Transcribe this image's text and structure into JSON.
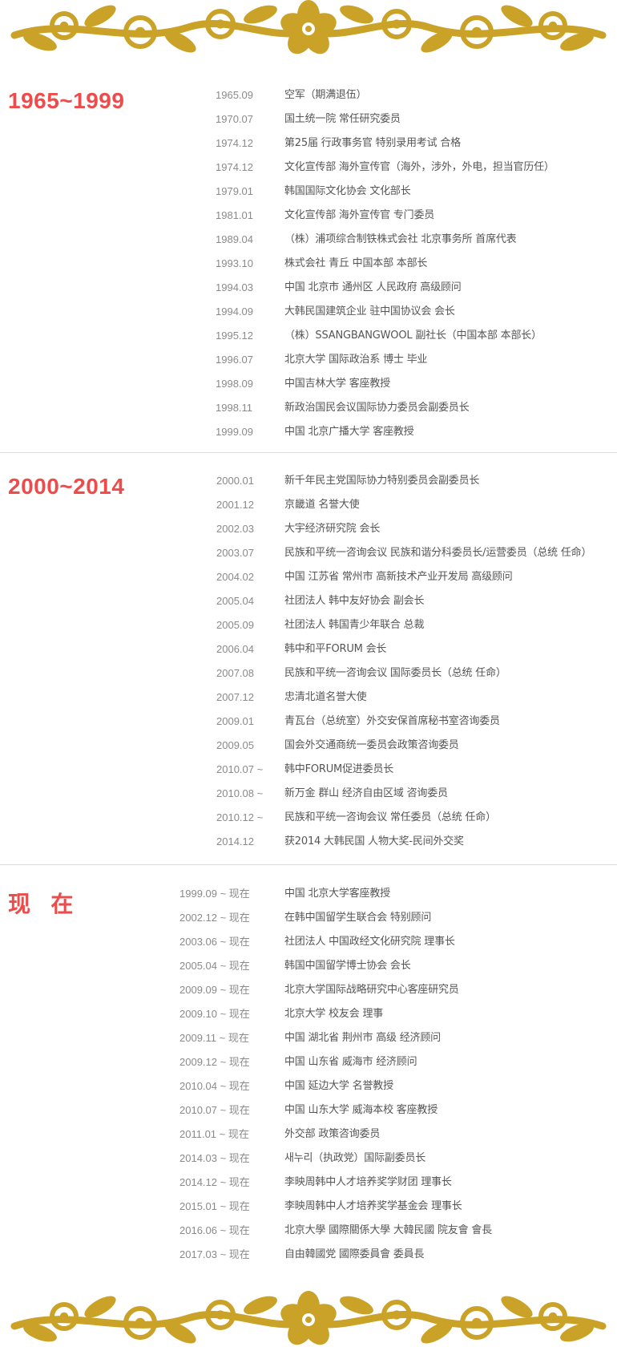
{
  "ornament": {
    "color": "#c9a227",
    "icon": "floral-ornament"
  },
  "sections": [
    {
      "title": "1965~1999",
      "entries": [
        {
          "date": "1965.09",
          "desc": "空军（期满退伍）"
        },
        {
          "date": "1970.07",
          "desc": "国土统一院 常任研究委员"
        },
        {
          "date": "1974.12",
          "desc": "第25届 行政事务官 特别录用考试 合格"
        },
        {
          "date": "1974.12",
          "desc": "文化宣传部 海外宣传官（海外，涉外，外电，担当官历任）"
        },
        {
          "date": "1979.01",
          "desc": "韩国国际文化协会 文化部长"
        },
        {
          "date": "1981.01",
          "desc": "文化宣传部 海外宣传官 专门委员"
        },
        {
          "date": "1989.04",
          "desc": "（株）浦项综合制铁株式会社 北京事务所 首席代表"
        },
        {
          "date": "1993.10",
          "desc": "株式会社 青丘 中国本部  本部长"
        },
        {
          "date": "1994.03",
          "desc": "中国 北京市 通州区 人民政府 高级顾问"
        },
        {
          "date": "1994.09",
          "desc": "大韩民国建筑企业 驻中国协议会 会长"
        },
        {
          "date": "1995.12",
          "desc": "（株）SSANGBANGWOOL 副社长（中国本部 本部长）"
        },
        {
          "date": "1996.07",
          "desc": "北京大学 国际政治系 博士 毕业"
        },
        {
          "date": "1998.09",
          "desc": "中国吉林大学 客座教授"
        },
        {
          "date": "1998.11",
          "desc": "新政治国民会议国际协力委员会副委员长"
        },
        {
          "date": "1999.09",
          "desc": "中国 北京广播大学 客座教授"
        }
      ]
    },
    {
      "title": "2000~2014",
      "entries": [
        {
          "date": "2000.01",
          "desc": "新千年民主党国际协力特别委员会副委员长"
        },
        {
          "date": "2001.12",
          "desc": "京畿道 名誉大使"
        },
        {
          "date": "2002.03",
          "desc": "大宇经济研究院 会长"
        },
        {
          "date": "2003.07",
          "desc": "民族和平统一咨询会议 民族和谐分科委员长/运营委员（总统 任命）"
        },
        {
          "date": "2004.02",
          "desc": "中国 江苏省 常州市 高新技术产业开发局 高级顾问"
        },
        {
          "date": "2005.04",
          "desc": "社团法人 韩中友好协会 副会长"
        },
        {
          "date": "2005.09",
          "desc": "社团法人 韩国青少年联合 总裁"
        },
        {
          "date": "2006.04",
          "desc": "韩中和平FORUM 会长"
        },
        {
          "date": "2007.08",
          "desc": "民族和平统一咨询会议 国际委员长（总统 任命）"
        },
        {
          "date": "2007.12",
          "desc": "忠清北道名誉大使"
        },
        {
          "date": "2009.01",
          "desc": "青瓦台（总统室）外交安保首席秘书室咨询委员"
        },
        {
          "date": "2009.05",
          "desc": "国会外交通商统一委员会政策咨询委员"
        },
        {
          "date": "2010.07 ~",
          "desc": "韩中FORUM促进委员长"
        },
        {
          "date": "2010.08 ~",
          "desc": "新万金 群山  经济自由区域 咨询委员"
        },
        {
          "date": "2010.12 ~",
          "desc": "民族和平统一咨询会议 常任委员（总统 任命）"
        },
        {
          "date": "2014.12",
          "desc": "获2014 大韩民国 人物大奖-民间外交奖"
        }
      ]
    },
    {
      "title": "现   在",
      "entries": [
        {
          "date": "1999.09 ~ 现在",
          "desc": "中国 北京大学客座教授"
        },
        {
          "date": "2002.12 ~ 现在",
          "desc": "在韩中国留学生联合会 特别顾问"
        },
        {
          "date": "2003.06 ~ 现在",
          "desc": "社团法人 中国政经文化研究院 理事长"
        },
        {
          "date": "2005.04 ~ 现在",
          "desc": "韩国中国留学博士协会 会长"
        },
        {
          "date": "2009.09 ~ 现在",
          "desc": "北京大学国际战略研究中心客座研究员"
        },
        {
          "date": "2009.10 ~ 现在",
          "desc": "北京大学 校友会 理事"
        },
        {
          "date": "2009.11 ~ 现在",
          "desc": "中国 湖北省 荆州市 高级 经济顾问"
        },
        {
          "date": "2009.12 ~ 现在",
          "desc": "中国 山东省 威海市 经济顾问"
        },
        {
          "date": "2010.04 ~ 现在",
          "desc": "中国 延边大学 名誉教授"
        },
        {
          "date": "2010.07 ~ 现在",
          "desc": "中国 山东大学 威海本校 客座教授"
        },
        {
          "date": "2011.01 ~ 现在",
          "desc": "外交部 政策咨询委员"
        },
        {
          "date": "2014.03 ~ 现在",
          "desc": "새누리（执政党）国际副委员长"
        },
        {
          "date": "2014.12 ~ 现在",
          "desc": "李映周韩中人才培养奖学财团 理事长"
        },
        {
          "date": "2015.01 ~ 现在",
          "desc": "李映周韩中人才培养奖学基金会 理事长"
        },
        {
          "date": "2016.06 ~ 现在",
          "desc": "北京大學 國際關係大學 大韓民國 院友會 會長"
        },
        {
          "date": "2017.03 ~ 现在",
          "desc": "自由韓國党 國際委員會 委員長"
        }
      ]
    }
  ]
}
